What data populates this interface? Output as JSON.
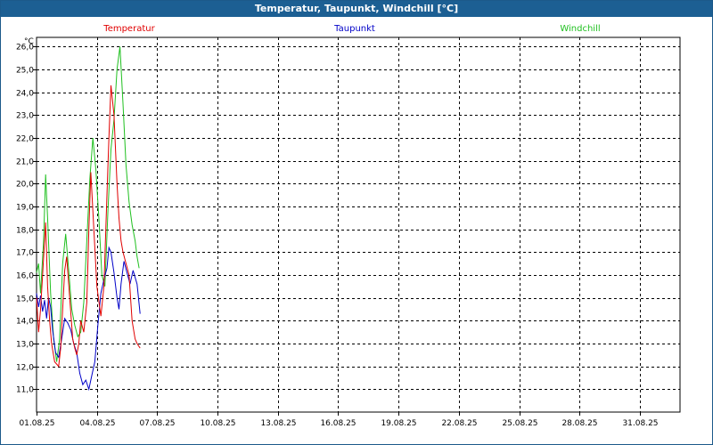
{
  "window": {
    "title": "Temperatur, Taupunkt, Windchill [°C]"
  },
  "chart_data": {
    "type": "line",
    "title": "Temperatur, Taupunkt, Windchill [°C]",
    "ylabel": "°C",
    "xlabel": "",
    "ylim": [
      10.0,
      26.4
    ],
    "xlim": [
      0,
      32
    ],
    "grid": true,
    "legend_position": "top",
    "y_ticks": [
      "11,0",
      "12,0",
      "13,0",
      "14,0",
      "15,0",
      "16,0",
      "17,0",
      "18,0",
      "19,0",
      "20,0",
      "21,0",
      "22,0",
      "23,0",
      "24,0",
      "25,0",
      "26,0"
    ],
    "x_ticks": [
      "01.08.25",
      "04.08.25",
      "07.08.25",
      "10.08.25",
      "13.08.25",
      "16.08.25",
      "19.08.25",
      "22.08.25",
      "25.08.25",
      "28.08.25",
      "31.08.25"
    ],
    "x_tick_days": [
      0,
      3,
      6,
      9,
      12,
      15,
      18,
      21,
      24,
      27,
      30
    ],
    "series": [
      {
        "name": "Temperatur",
        "color": "#e00000",
        "x": [
          0.0,
          0.1,
          0.2,
          0.3,
          0.45,
          0.55,
          0.65,
          0.75,
          0.9,
          1.1,
          1.2,
          1.3,
          1.4,
          1.5,
          1.65,
          1.8,
          1.9,
          2.0,
          2.1,
          2.2,
          2.35,
          2.5,
          2.6,
          2.7,
          2.85,
          3.0,
          3.2,
          3.35,
          3.5,
          3.6,
          3.7,
          3.85,
          4.0,
          4.1,
          4.2,
          4.3,
          4.45,
          4.6,
          4.75,
          4.9,
          5.0,
          5.15
        ],
        "values": [
          15.0,
          13.5,
          14.5,
          16.0,
          18.3,
          15.5,
          14.0,
          13.0,
          12.2,
          12.0,
          12.8,
          14.5,
          16.2,
          16.8,
          15.0,
          13.2,
          12.8,
          12.5,
          13.0,
          14.0,
          13.5,
          14.8,
          18.0,
          20.5,
          18.0,
          15.5,
          14.2,
          15.5,
          19.5,
          22.0,
          24.3,
          23.0,
          20.0,
          18.5,
          17.5,
          17.0,
          16.5,
          16.0,
          14.0,
          13.2,
          13.0,
          12.8
        ]
      },
      {
        "name": "Taupunkt",
        "color": "#0000c8",
        "x": [
          0.0,
          0.1,
          0.2,
          0.3,
          0.4,
          0.5,
          0.6,
          0.7,
          0.8,
          0.95,
          1.1,
          1.25,
          1.4,
          1.55,
          1.7,
          1.85,
          2.0,
          2.15,
          2.3,
          2.45,
          2.6,
          2.75,
          2.9,
          3.05,
          3.2,
          3.35,
          3.5,
          3.6,
          3.7,
          3.85,
          4.0,
          4.1,
          4.2,
          4.35,
          4.5,
          4.65,
          4.8,
          5.0,
          5.15
        ],
        "values": [
          15.2,
          14.6,
          15.1,
          14.4,
          14.9,
          14.1,
          15.0,
          14.6,
          13.6,
          12.6,
          12.4,
          13.2,
          14.1,
          13.9,
          13.6,
          13.0,
          12.6,
          11.7,
          11.2,
          11.4,
          11.0,
          11.6,
          12.2,
          13.8,
          15.2,
          15.8,
          16.3,
          17.2,
          17.0,
          16.1,
          15.0,
          14.5,
          15.6,
          16.6,
          16.1,
          15.6,
          16.2,
          15.6,
          14.3
        ]
      },
      {
        "name": "Windchill",
        "color": "#20c020",
        "x": [
          0.0,
          0.1,
          0.2,
          0.35,
          0.45,
          0.55,
          0.7,
          0.85,
          1.0,
          1.15,
          1.3,
          1.45,
          1.6,
          1.75,
          1.9,
          2.05,
          2.2,
          2.35,
          2.5,
          2.65,
          2.8,
          2.95,
          3.1,
          3.25,
          3.4,
          3.55,
          3.7,
          3.85,
          4.0,
          4.15,
          4.3,
          4.45,
          4.6,
          4.75,
          4.9,
          5.0,
          5.1
        ],
        "values": [
          16.1,
          16.5,
          15.2,
          17.5,
          20.4,
          18.5,
          15.2,
          13.2,
          12.2,
          13.2,
          16.5,
          17.8,
          16.2,
          14.5,
          13.8,
          13.3,
          13.5,
          14.8,
          17.5,
          20.2,
          22.0,
          20.6,
          18.5,
          16.0,
          15.5,
          18.8,
          21.5,
          22.8,
          25.0,
          26.0,
          23.5,
          20.8,
          19.2,
          18.2,
          17.5,
          16.8,
          16.3
        ]
      }
    ]
  }
}
